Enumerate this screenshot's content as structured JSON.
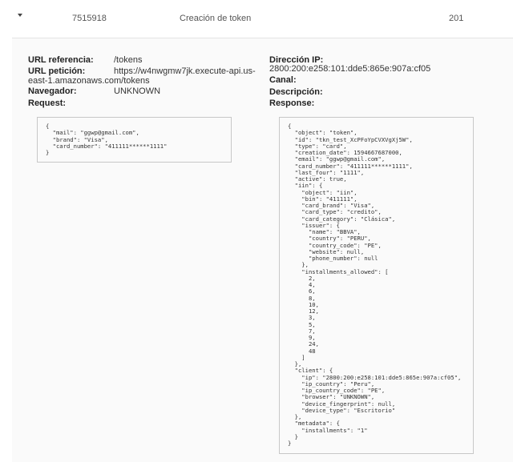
{
  "row": {
    "id": "7515918",
    "event": "Creación de token",
    "status_code": "201"
  },
  "left": {
    "url_ref_label": "URL referencia:",
    "url_ref_value": "/tokens",
    "url_pet_label": "URL petición:",
    "url_pet_value_line1": "https://w4nwgmw7jk.execute-api.us-",
    "url_pet_value_line2": "east-1.amazonaws.com/tokens",
    "browser_label": "Navegador:",
    "browser_value": "UNKNOWN",
    "request_label": "Request:",
    "request_body": "{\n  \"mail\": \"ggwp@gmail.com\",\n  \"brand\": \"Visa\",\n  \"card_number\": \"411111******1111\"\n}"
  },
  "right": {
    "ip_label": "Dirección IP:",
    "ip_value": "2800:200:e258:101:dde5:865e:907a:cf05",
    "channel_label": "Canal:",
    "description_label": "Descripción:",
    "response_label": "Response:",
    "response_body": "{\n  \"object\": \"token\",\n  \"id\": \"tkn_test_XcPFoYpCVXVgXj5W\",\n  \"type\": \"card\",\n  \"creation_date\": 1594667687000,\n  \"email\": \"ggwp@gmail.com\",\n  \"card_number\": \"411111******1111\",\n  \"last_four\": \"1111\",\n  \"active\": true,\n  \"iin\": {\n    \"object\": \"iin\",\n    \"bin\": \"411111\",\n    \"card_brand\": \"Visa\",\n    \"card_type\": \"credito\",\n    \"card_category\": \"Clásica\",\n    \"issuer\": {\n      \"name\": \"BBVA\",\n      \"country\": \"PERU\",\n      \"country_code\": \"PE\",\n      \"website\": null,\n      \"phone_number\": null\n    },\n    \"installments_allowed\": [\n      2,\n      4,\n      6,\n      8,\n      10,\n      12,\n      3,\n      5,\n      7,\n      9,\n      24,\n      48\n    ]\n  },\n  \"client\": {\n    \"ip\": \"2800:200:e258:101:dde5:865e:907a:cf05\",\n    \"ip_country\": \"Peru\",\n    \"ip_country_code\": \"PE\",\n    \"browser\": \"UNKNOWN\",\n    \"device_fingerprint\": null,\n    \"device_type\": \"Escritorio\"\n  },\n  \"metadata\": {\n    \"installments\": \"1\"\n  }\n}"
  }
}
